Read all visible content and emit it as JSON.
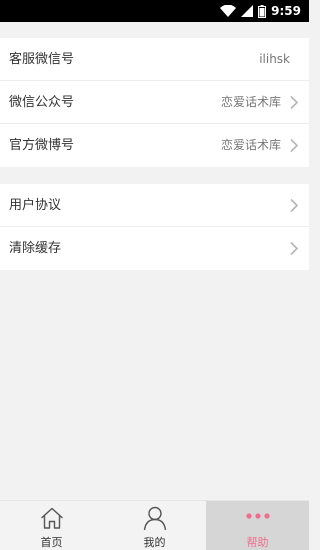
{
  "status_bar": {
    "time": "9:59"
  },
  "settings": {
    "group1": [
      {
        "label": "客服微信号",
        "value": "ilihsk"
      },
      {
        "label": "微信公众号",
        "value": "恋爱话术库"
      },
      {
        "label": "官方微博号",
        "value": "恋爱话术库"
      }
    ],
    "group2": [
      {
        "label": "用户协议"
      },
      {
        "label": "清除缓存"
      }
    ]
  },
  "tab_bar": {
    "tabs": [
      {
        "label": "首页",
        "icon": "home-icon"
      },
      {
        "label": "我的",
        "icon": "user-icon"
      },
      {
        "label": "帮助",
        "icon": "more-dots-icon",
        "active": true
      }
    ]
  },
  "colors": {
    "accent": "#f06d8f",
    "active_tab_bg": "#d6d6d6"
  }
}
